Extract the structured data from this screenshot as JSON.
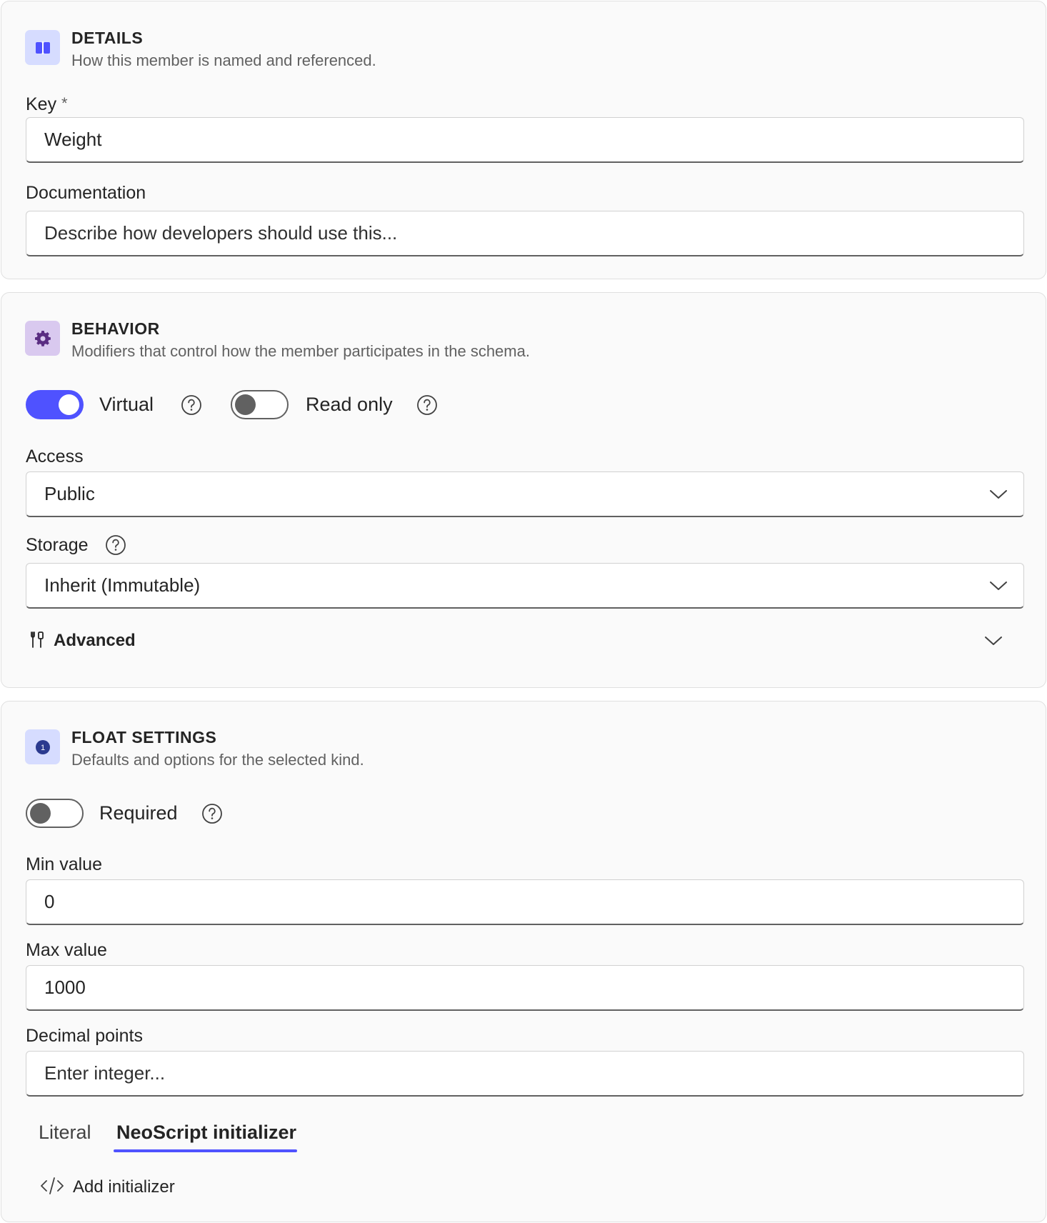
{
  "details": {
    "title": "DETAILS",
    "subtitle": "How this member is named and referenced.",
    "icon": "book-icon",
    "key_label": "Key",
    "key_required_mark": "*",
    "key_value": "Weight",
    "doc_label": "Documentation",
    "doc_placeholder": "Describe how developers should use this..."
  },
  "behavior": {
    "title": "BEHAVIOR",
    "subtitle": "Modifiers that control how the member participates in the schema.",
    "icon": "gear-icon",
    "virtual_label": "Virtual",
    "virtual_on": true,
    "readonly_label": "Read only",
    "readonly_on": false,
    "access_label": "Access",
    "access_value": "Public",
    "storage_label": "Storage",
    "storage_value": "Inherit (Immutable)",
    "advanced_label": "Advanced"
  },
  "float_settings": {
    "title": "FLOAT SETTINGS",
    "subtitle": "Defaults and options for the selected kind.",
    "icon": "number-one-icon",
    "icon_glyph": "1",
    "required_label": "Required",
    "required_on": false,
    "min_label": "Min value",
    "min_value": "0",
    "max_label": "Max value",
    "max_value": "1000",
    "decimal_label": "Decimal points",
    "decimal_placeholder": "Enter integer...",
    "tabs": [
      "Literal",
      "NeoScript initializer"
    ],
    "active_tab": "NeoScript initializer",
    "add_initializer_label": "Add initializer"
  },
  "colors": {
    "accent": "#4f52ff",
    "card_bg": "#fafafa",
    "details_icon_bg": "#d6dcff",
    "behavior_icon_bg": "#d9c9ef",
    "float_icon_bg": "#d6dcff"
  }
}
